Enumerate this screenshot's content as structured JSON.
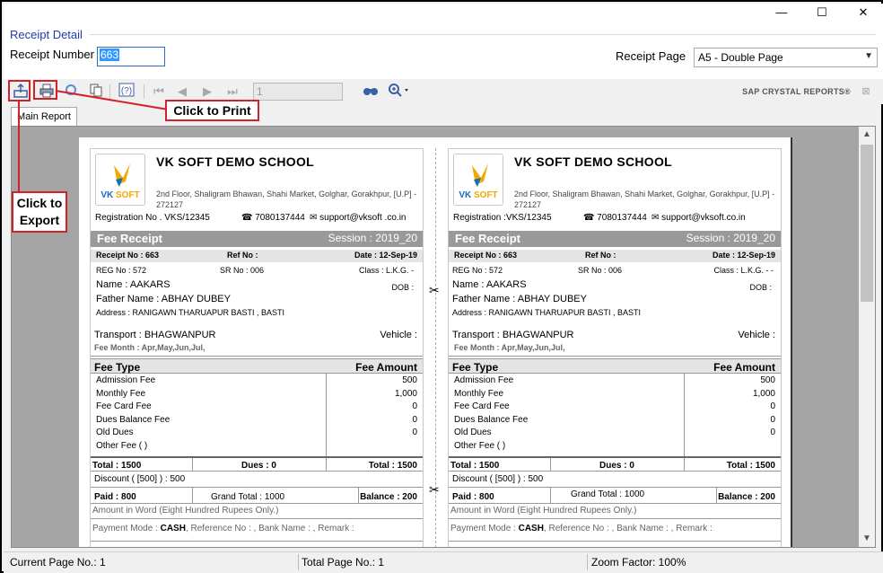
{
  "window": {
    "minimize_glyph": "—",
    "maximize_glyph": "☐",
    "close_glyph": "✕"
  },
  "form": {
    "section_title": "Receipt Detail",
    "receipt_number_label": "Receipt Number",
    "receipt_number_value": "663",
    "receipt_page_label": "Receipt Page",
    "receipt_page_value": "A5 - Double Page"
  },
  "toolbar": {
    "page_input_value": "1",
    "brand_text": "SAP CRYSTAL REPORTS®",
    "tab_label": "Main Report"
  },
  "receipts": [
    {
      "school_name": "VK SOFT DEMO SCHOOL",
      "address": "2nd Floor, Shaligram Bhawan, Shahi Market, Golghar, Gorakhpur,  [U.P] - 272127",
      "registration": "Registration No . VKS/12345",
      "phone": "7080137444",
      "email": "support@vksoft .co.in",
      "title": "Fee Receipt",
      "session": "Session : 2019_20",
      "receipt_no": "Receipt No :  663",
      "ref_no": "Ref No :",
      "date": "Date :  12-Sep-19",
      "reg_no": "REG No : 572",
      "sr_no": "SR No : 006",
      "class": "Class : L.K.G. -",
      "name": "Name  :  AAKARS",
      "dob": "DOB :",
      "father": "Father Name  :  ABHAY DUBEY",
      "address_student": "Address : RANIGAWN THARUAPUR BASTI , BASTI",
      "transport": "Transport : BHAGWANPUR",
      "vehicle": "Vehicle :",
      "fee_month": "Fee Month   : Apr,May,Jun,Jul,",
      "fee_type_header": "Fee Type",
      "fee_amount_header": "Fee Amount",
      "fees": [
        {
          "name": "Admission Fee",
          "amount": "500"
        },
        {
          "name": "Monthly Fee",
          "amount": "1,000"
        },
        {
          "name": "Fee Card Fee",
          "amount": "0"
        },
        {
          "name": "Dues Balance Fee",
          "amount": "0"
        },
        {
          "name": "Old Dues",
          "amount": "0"
        },
        {
          "name": "Other Fee (                                              )",
          "amount": ""
        }
      ],
      "total_left": "Total : 1500",
      "dues": "Dues : 0",
      "total_right": "Total : 1500",
      "discount": "Discount ( [500] ) : 500",
      "paid": "Paid : 800",
      "grand_total": "Grand Total : 1000",
      "balance": "Balance :  200",
      "amount_word": "Amount in Word  (Eight Hundred Rupees Only.)",
      "payment_mode_label": "Payment Mode : ",
      "payment_mode_value": "CASH",
      "payment_rest": ", Reference No : , Bank Name : , Remark :"
    },
    {
      "school_name": "VK SOFT DEMO SCHOOL",
      "address": "2nd Floor, Shaligram Bhawan, Shahi Market, Golghar, Gorakhpur,   [U.P] - 272127",
      "registration": "Registration  :VKS/12345",
      "phone": "7080137444",
      "email": "support@vksoft.co.in",
      "title": "Fee Receipt",
      "session": "Session : 2019_20",
      "receipt_no": "Receipt No :  663",
      "ref_no": "Ref No :",
      "date": "Date :  12-Sep-19",
      "reg_no": "REG No : 572",
      "sr_no": "SR No : 006",
      "class": "Class : L.K.G. -  -",
      "name": "Name  :  AAKARS",
      "dob": "DOB :",
      "father": "Father Name  :  ABHAY DUBEY",
      "address_student": "Address : RANIGAWN THARUAPUR BASTI , BASTI",
      "transport": "Transport : BHAGWANPUR",
      "vehicle": "Vehicle :",
      "fee_month": "Fee Month   : Apr,May,Jun,Jul,",
      "fee_type_header": "Fee Type",
      "fee_amount_header": "Fee Amount",
      "fees": [
        {
          "name": "Admission Fee",
          "amount": "500"
        },
        {
          "name": "Monthly Fee",
          "amount": "1,000"
        },
        {
          "name": "Fee Card Fee",
          "amount": "0"
        },
        {
          "name": "Dues Balance Fee",
          "amount": "0"
        },
        {
          "name": "Old Dues",
          "amount": "0"
        },
        {
          "name": "Other Fee (                                              )",
          "amount": ""
        }
      ],
      "total_left": "Total : 1500",
      "dues": "Dues : 0",
      "total_right": "Total : 1500",
      "discount": "Discount ( [500] ) : 500",
      "paid": "Paid : 800",
      "grand_total": "Grand Total : 1000",
      "balance": "Balance :  200",
      "amount_word": "Amount in Word  (Eight Hundred Rupees Only.)",
      "payment_mode_label": "Payment Mode : ",
      "payment_mode_value": "CASH",
      "payment_rest": ", Reference No : , Bank Name : , Remark :"
    }
  ],
  "logo_brand": {
    "vk": "VK",
    "soft": "SOFT"
  },
  "status": {
    "current_page": "Current Page No.: 1",
    "total_page": "Total Page No.: 1",
    "zoom": "Zoom Factor: 100%"
  },
  "callouts": {
    "print": "Click to Print",
    "export": "Click to Export"
  },
  "colors": {
    "accent_red": "#d3212a",
    "band_gray": "#999999",
    "title_blue": "#1a3ea8"
  }
}
